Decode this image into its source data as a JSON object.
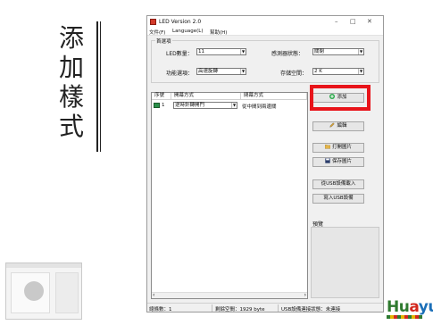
{
  "slide": {
    "title_chars": [
      "添",
      "加",
      "樣",
      "式"
    ],
    "logo": {
      "part1": "Hu",
      "part2": "a",
      "part3": "yu"
    }
  },
  "window": {
    "title": "LED   Version 2.0",
    "controls": {
      "minimize": "–",
      "maximize": "□",
      "close": "✕"
    },
    "menu": [
      "文件(F)",
      "Language(L)",
      "幫助(H)"
    ]
  },
  "options": {
    "group_label": "首選項",
    "led_count_label": "LED數量：",
    "led_count_value": "11",
    "sensor_label": "感測器狀態：",
    "sensor_value": "關閉",
    "function_label": "功能選項：",
    "function_value": "高速旋轉",
    "storage_label": "存儲空間：",
    "storage_value": "2 K"
  },
  "list": {
    "columns": [
      "序號",
      "開幕方式",
      "閉幕方式"
    ],
    "rows": [
      {
        "index": "1",
        "open": "逆時針轉開門",
        "close": "從中間到兩邊關"
      }
    ],
    "scroll_left": "‹",
    "scroll_right": "›"
  },
  "buttons": {
    "add": "添加",
    "edit": "編輯",
    "open_image": "打開圖片",
    "save_image": "保存圖片",
    "usb_load": "從USB設備載入",
    "usb_write": "寫入USB設備"
  },
  "preview": {
    "label": "預覽"
  },
  "status": {
    "count": "總條數：1",
    "free": "剩餘空間：1929 byte",
    "usb": "USB設備連接狀態：未連接"
  },
  "colors": {
    "highlight": "#e8141a",
    "add_icon": "#2aa84a"
  }
}
